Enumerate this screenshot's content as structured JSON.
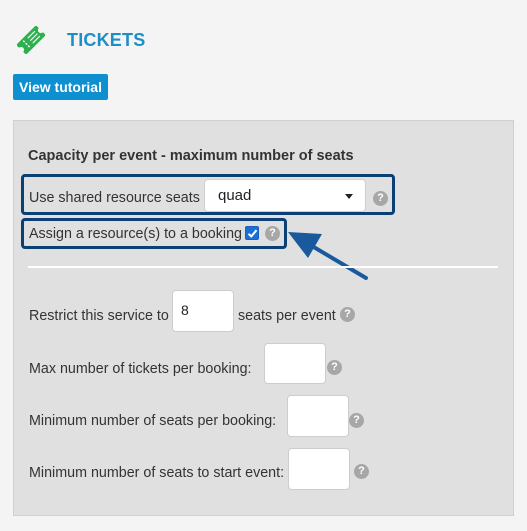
{
  "header": {
    "title": "TICKETS",
    "icon": "ticket-icon",
    "accent_color": "#1e8fc6"
  },
  "toolbar": {
    "tutorial_label": "View tutorial",
    "button_color": "#0e8fd0"
  },
  "capacity": {
    "section_title": "Capacity per event - maximum number of seats",
    "shared_resource_label": "Use shared resource seats",
    "shared_resource_value": "quad",
    "assign_resource_label": "Assign a resource(s) to a booking",
    "assign_resource_checked": true,
    "highlight_color": "#0c3f74"
  },
  "limits": {
    "restrict_label_before": "Restrict this service to",
    "restrict_value": "8",
    "restrict_label_after": "seats per event",
    "max_tickets_label": "Max number of tickets per booking:",
    "max_tickets_value": "",
    "min_seats_booking_label": "Minimum number of seats per booking:",
    "min_seats_booking_value": "",
    "min_seats_start_label": "Minimum number of seats to start event:",
    "min_seats_start_value": ""
  },
  "help_glyph": "?"
}
